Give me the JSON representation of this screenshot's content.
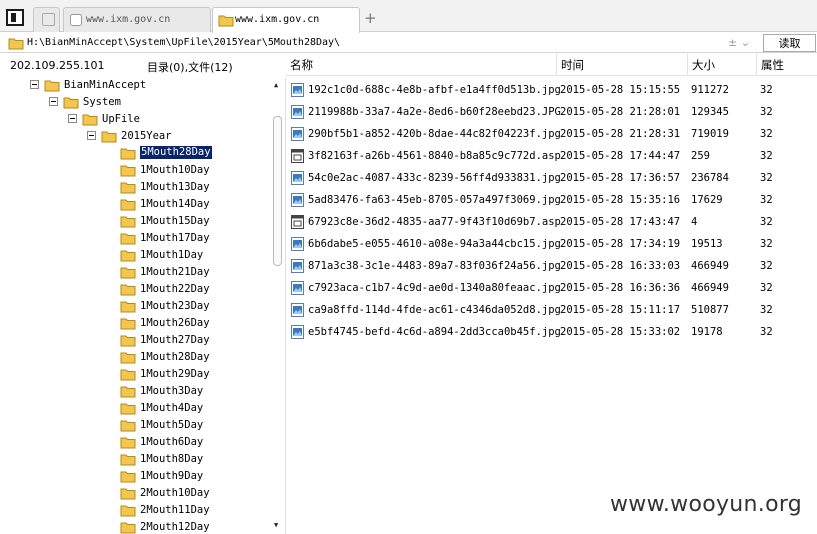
{
  "tabs": [
    {
      "label": "www.ixm.gov.cn",
      "active": false
    },
    {
      "label": "www.ixm.gov.cn",
      "active": true
    }
  ],
  "new_tab_label": "+",
  "path": {
    "value": "H:\\BianMinAccept\\System\\UpFile\\2015Year\\5Mouth28Day\\",
    "action": "± ⌄",
    "read_label": "读取"
  },
  "status": {
    "ip": "202.109.255.101",
    "counts": "目录(0),文件(12)"
  },
  "columns": {
    "name": "名称",
    "time": "时间",
    "size": "大小",
    "attr": "属性"
  },
  "tree": [
    {
      "label": "BianMinAccept",
      "level": 0,
      "expander": true,
      "open": true
    },
    {
      "label": "System",
      "level": 1,
      "expander": true,
      "open": true
    },
    {
      "label": "UpFile",
      "level": 2,
      "expander": true,
      "open": true
    },
    {
      "label": "2015Year",
      "level": 3,
      "expander": true,
      "open": true
    },
    {
      "label": "5Mouth28Day",
      "level": 4,
      "selected": true
    },
    {
      "label": "1Mouth10Day",
      "level": 4
    },
    {
      "label": "1Mouth13Day",
      "level": 4
    },
    {
      "label": "1Mouth14Day",
      "level": 4
    },
    {
      "label": "1Mouth15Day",
      "level": 4
    },
    {
      "label": "1Mouth17Day",
      "level": 4
    },
    {
      "label": "1Mouth1Day",
      "level": 4
    },
    {
      "label": "1Mouth21Day",
      "level": 4
    },
    {
      "label": "1Mouth22Day",
      "level": 4
    },
    {
      "label": "1Mouth23Day",
      "level": 4
    },
    {
      "label": "1Mouth26Day",
      "level": 4
    },
    {
      "label": "1Mouth27Day",
      "level": 4
    },
    {
      "label": "1Mouth28Day",
      "level": 4
    },
    {
      "label": "1Mouth29Day",
      "level": 4
    },
    {
      "label": "1Mouth3Day",
      "level": 4
    },
    {
      "label": "1Mouth4Day",
      "level": 4
    },
    {
      "label": "1Mouth5Day",
      "level": 4
    },
    {
      "label": "1Mouth6Day",
      "level": 4
    },
    {
      "label": "1Mouth8Day",
      "level": 4
    },
    {
      "label": "1Mouth9Day",
      "level": 4
    },
    {
      "label": "2Mouth10Day",
      "level": 4
    },
    {
      "label": "2Mouth11Day",
      "level": 4
    },
    {
      "label": "2Mouth12Day",
      "level": 4
    }
  ],
  "files": [
    {
      "name": "192c1c0d-688c-4e8b-afbf-e1a4ff0d513b.jpg",
      "time": "2015-05-28 15:15:55",
      "size": "911272",
      "attr": "32",
      "icon": "image-file-icon"
    },
    {
      "name": "2119988b-33a7-4a2e-8ed6-b60f28eebd23.JPG",
      "time": "2015-05-28 21:28:01",
      "size": "129345",
      "attr": "32",
      "icon": "image-file-icon"
    },
    {
      "name": "290bf5b1-a852-420b-8dae-44c82f04223f.jpg",
      "time": "2015-05-28 21:28:31",
      "size": "719019",
      "attr": "32",
      "icon": "image-file-icon"
    },
    {
      "name": "3f82163f-a26b-4561-8840-b8a85c9c772d.asp",
      "time": "2015-05-28 17:44:47",
      "size": "259",
      "attr": "32",
      "icon": "asp-file-icon"
    },
    {
      "name": "54c0e2ac-4087-433c-8239-56ff4d933831.jpg",
      "time": "2015-05-28 17:36:57",
      "size": "236784",
      "attr": "32",
      "icon": "image-file-icon"
    },
    {
      "name": "5ad83476-fa63-45eb-8705-057a497f3069.jpg",
      "time": "2015-05-28 15:35:16",
      "size": "17629",
      "attr": "32",
      "icon": "image-file-icon"
    },
    {
      "name": "67923c8e-36d2-4835-aa77-9f43f10d69b7.asp",
      "time": "2015-05-28 17:43:47",
      "size": "4",
      "attr": "32",
      "icon": "asp-file-icon"
    },
    {
      "name": "6b6dabe5-e055-4610-a08e-94a3a44cbc15.jpg",
      "time": "2015-05-28 17:34:19",
      "size": "19513",
      "attr": "32",
      "icon": "image-file-icon"
    },
    {
      "name": "871a3c38-3c1e-4483-89a7-83f036f24a56.jpg",
      "time": "2015-05-28 16:33:03",
      "size": "466949",
      "attr": "32",
      "icon": "image-file-icon"
    },
    {
      "name": "c7923aca-c1b7-4c9d-ae0d-1340a80feaac.jpg",
      "time": "2015-05-28 16:36:36",
      "size": "466949",
      "attr": "32",
      "icon": "image-file-icon"
    },
    {
      "name": "ca9a8ffd-114d-4fde-ac61-c4346da052d8.jpg",
      "time": "2015-05-28 15:11:17",
      "size": "510877",
      "attr": "32",
      "icon": "image-file-icon"
    },
    {
      "name": "e5bf4745-befd-4c6d-a894-2dd3cca0b45f.jpg",
      "time": "2015-05-28 15:33:02",
      "size": "19178",
      "attr": "32",
      "icon": "image-file-icon"
    }
  ],
  "watermark": "www.wooyun.org",
  "colors": {
    "selection": "#0a246a",
    "folder": "#f3c74d",
    "file_icon": "#2f6fb3"
  }
}
